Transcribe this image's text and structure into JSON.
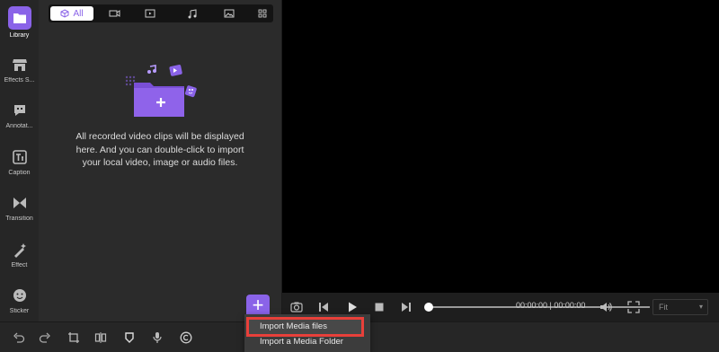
{
  "sidebar": {
    "items": [
      {
        "label": "Library",
        "icon": "folder-icon",
        "active": true
      },
      {
        "label": "Effects S...",
        "icon": "store-icon"
      },
      {
        "label": "Annotat...",
        "icon": "annotation-icon"
      },
      {
        "label": "Caption",
        "icon": "caption-icon"
      },
      {
        "label": "Transition",
        "icon": "transition-icon"
      },
      {
        "label": "Effect",
        "icon": "magic-wand-icon"
      },
      {
        "label": "Sticker",
        "icon": "sticker-icon"
      }
    ]
  },
  "media": {
    "tabs": {
      "all_label": "All"
    },
    "empty_message": "All recorded video clips will be displayed here. And you can double-click to import your local video, image or audio files.",
    "add_label": "+"
  },
  "player": {
    "time": "00:00:00 | 00:00:00",
    "progress_fraction": 0.0,
    "fit_label": "Fit"
  },
  "import_menu": {
    "items": [
      "Import Media files",
      "Import a Media Folder"
    ]
  },
  "colors": {
    "accent": "#8a63e8",
    "highlight": "#e8403a"
  }
}
